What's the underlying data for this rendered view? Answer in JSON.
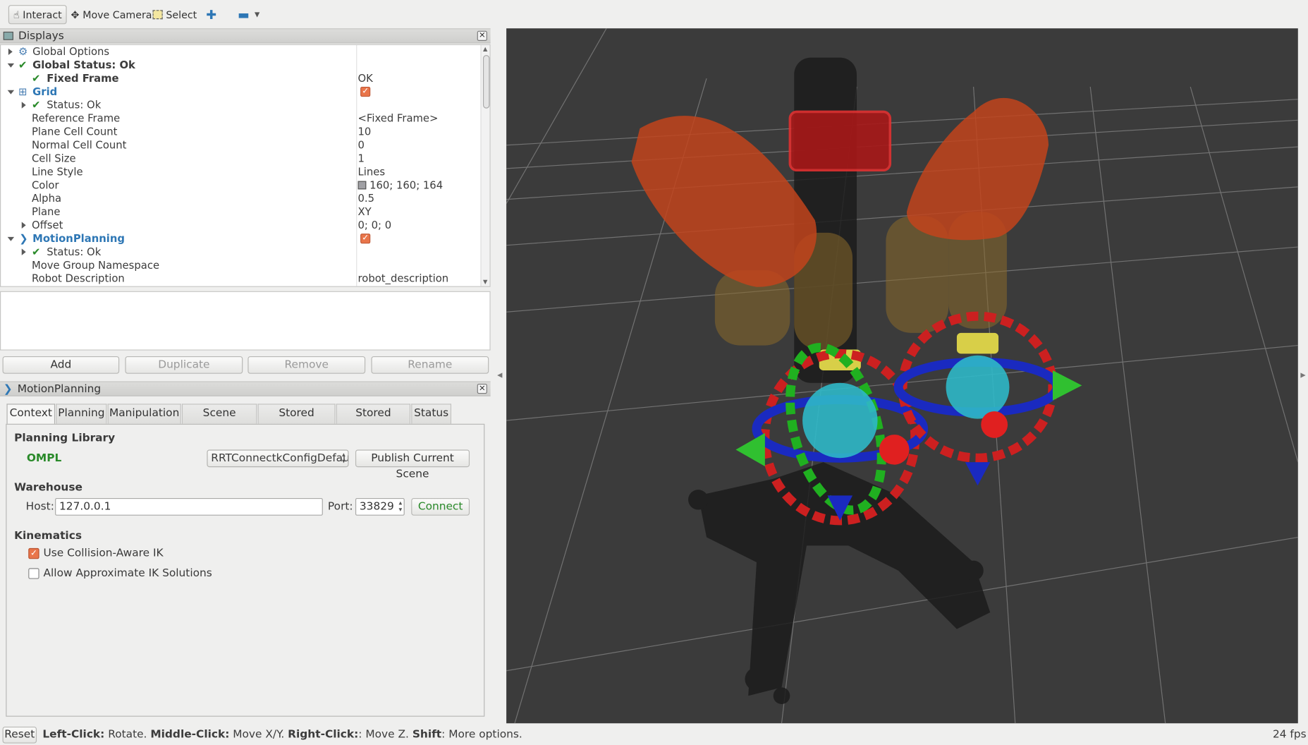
{
  "toolbar": {
    "interact": "Interact",
    "move_camera": "Move Camera",
    "select": "Select"
  },
  "displays": {
    "title": "Displays",
    "rows": [
      {
        "key": "Global Options",
        "value": ""
      },
      {
        "key": "Global Status: Ok",
        "value": ""
      },
      {
        "key": "Fixed Frame",
        "value": "OK"
      },
      {
        "key": "Grid",
        "value": ""
      },
      {
        "key": "Status: Ok",
        "value": ""
      },
      {
        "key": "Reference Frame",
        "value": "<Fixed Frame>"
      },
      {
        "key": "Plane Cell Count",
        "value": "10"
      },
      {
        "key": "Normal Cell Count",
        "value": "0"
      },
      {
        "key": "Cell Size",
        "value": "1"
      },
      {
        "key": "Line Style",
        "value": "Lines"
      },
      {
        "key": "Color",
        "value": "160; 160; 164"
      },
      {
        "key": "Alpha",
        "value": "0.5"
      },
      {
        "key": "Plane",
        "value": "XY"
      },
      {
        "key": "Offset",
        "value": "0; 0; 0"
      },
      {
        "key": "MotionPlanning",
        "value": ""
      },
      {
        "key": "Status: Ok",
        "value": ""
      },
      {
        "key": "Move Group Namespace",
        "value": ""
      },
      {
        "key": "Robot Description",
        "value": "robot_description"
      }
    ],
    "grid_color": "#a0a0a4",
    "buttons": {
      "add": "Add",
      "duplicate": "Duplicate",
      "remove": "Remove",
      "rename": "Rename"
    }
  },
  "motion_planning": {
    "title": "MotionPlanning",
    "tabs": [
      "Context",
      "Planning",
      "Manipulation",
      "Scene Objects",
      "Stored Scenes",
      "Stored States",
      "Status"
    ],
    "active_tab": "Context",
    "planning_library": {
      "heading": "Planning Library",
      "name": "OMPL",
      "planner": "RRTConnectkConfigDefaul",
      "publish_button": "Publish Current Scene"
    },
    "warehouse": {
      "heading": "Warehouse",
      "host_label": "Host:",
      "host": "127.0.0.1",
      "port_label": "Port:",
      "port": "33829",
      "connect_button": "Connect"
    },
    "kinematics": {
      "heading": "Kinematics",
      "collision_aware": {
        "label": "Use Collision-Aware IK",
        "checked": true
      },
      "approximate": {
        "label": "Allow Approximate IK Solutions",
        "checked": false
      }
    }
  },
  "statusbar": {
    "reset": "Reset",
    "left_click": "Left-Click:",
    "left_click_desc": " Rotate. ",
    "middle_click": "Middle-Click:",
    "middle_click_desc": " Move X/Y. ",
    "right_click": "Right-Click:",
    "right_click_desc": ": Move Z. ",
    "shift": "Shift",
    "shift_desc": ": More options.",
    "fps": "24 fps"
  },
  "colors": {
    "accent_orange": "#e9754a",
    "ok_green": "#2a8a2a",
    "link_blue": "#2e77b5",
    "viewport_bg": "#3b3b3b"
  }
}
